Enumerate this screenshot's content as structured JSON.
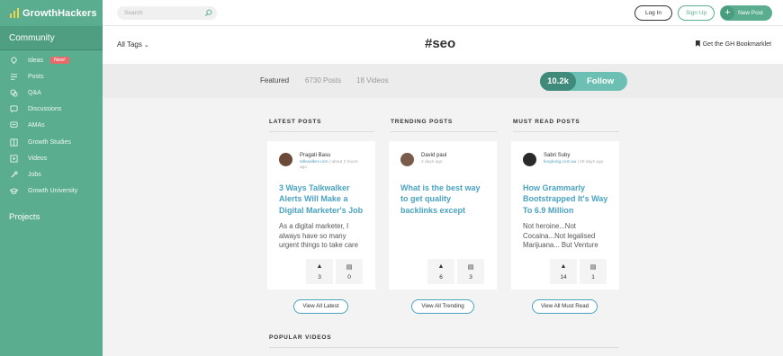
{
  "brand": {
    "name": "GrowthHackers"
  },
  "sidebar": {
    "community_title": "Community",
    "items": [
      {
        "label": "Ideas",
        "icon": "lightbulb-icon",
        "badge": "New!"
      },
      {
        "label": "Posts",
        "icon": "list-icon"
      },
      {
        "label": "Q&A",
        "icon": "chat-bubbles-icon"
      },
      {
        "label": "Discussions",
        "icon": "discussion-icon"
      },
      {
        "label": "AMAs",
        "icon": "ama-icon"
      },
      {
        "label": "Growth Studies",
        "icon": "book-icon"
      },
      {
        "label": "Videos",
        "icon": "play-icon"
      },
      {
        "label": "Jobs",
        "icon": "wrench-icon"
      },
      {
        "label": "Growth University",
        "icon": "graduation-cap-icon"
      }
    ],
    "projects_title": "Projects"
  },
  "topbar": {
    "search_placeholder": "Search",
    "login_label": "Log In",
    "signup_label": "Sign Up",
    "newpost_label": "New Post"
  },
  "header": {
    "all_tags_label": "All Tags",
    "tag_title": "#seo",
    "bookmarklet_label": "Get the GH Bookmarklet"
  },
  "tabs": {
    "featured": "Featured",
    "posts": "6730 Posts",
    "videos": "18 Videos",
    "follow_count": "10.2k",
    "follow_label": "Follow"
  },
  "columns": [
    {
      "title": "LATEST POSTS",
      "view_all": "View All Latest",
      "card": {
        "author": "Pragati Basu",
        "source": "talkwalker.com",
        "time": " | about 2 hours ago",
        "title": "3 Ways Talkwalker Alerts Will Make a Digital Marketer's Job",
        "excerpt": "As a digital marketer, I always have so many urgent things to take care",
        "upvotes": "3",
        "comments": "0"
      }
    },
    {
      "title": "TRENDING POSTS",
      "view_all": "View All Trending",
      "card": {
        "author": "David paul",
        "source": "",
        "time": "2 days ago",
        "title": "What is the best way to get quality backlinks except",
        "excerpt": "",
        "upvotes": "6",
        "comments": "3"
      }
    },
    {
      "title": "MUST READ POSTS",
      "view_all": "View All Must Read",
      "card": {
        "author": "Sabri Suby",
        "source": "kingkong.com.au",
        "time": " | 18 days ago",
        "title": "How Grammarly Bootstrapped It's Way To 6.9 Million",
        "excerpt": "Not heroine...Not Cocaina...Not legalised Marijuana... But Venture",
        "upvotes": "14",
        "comments": "1"
      }
    }
  ],
  "popular_videos_title": "POPULAR VIDEOS",
  "colors": {
    "brand": "#5aad8f",
    "link": "#4aa3c2",
    "follow_dark": "#3f8a7a",
    "badge": "#e86a6a"
  }
}
